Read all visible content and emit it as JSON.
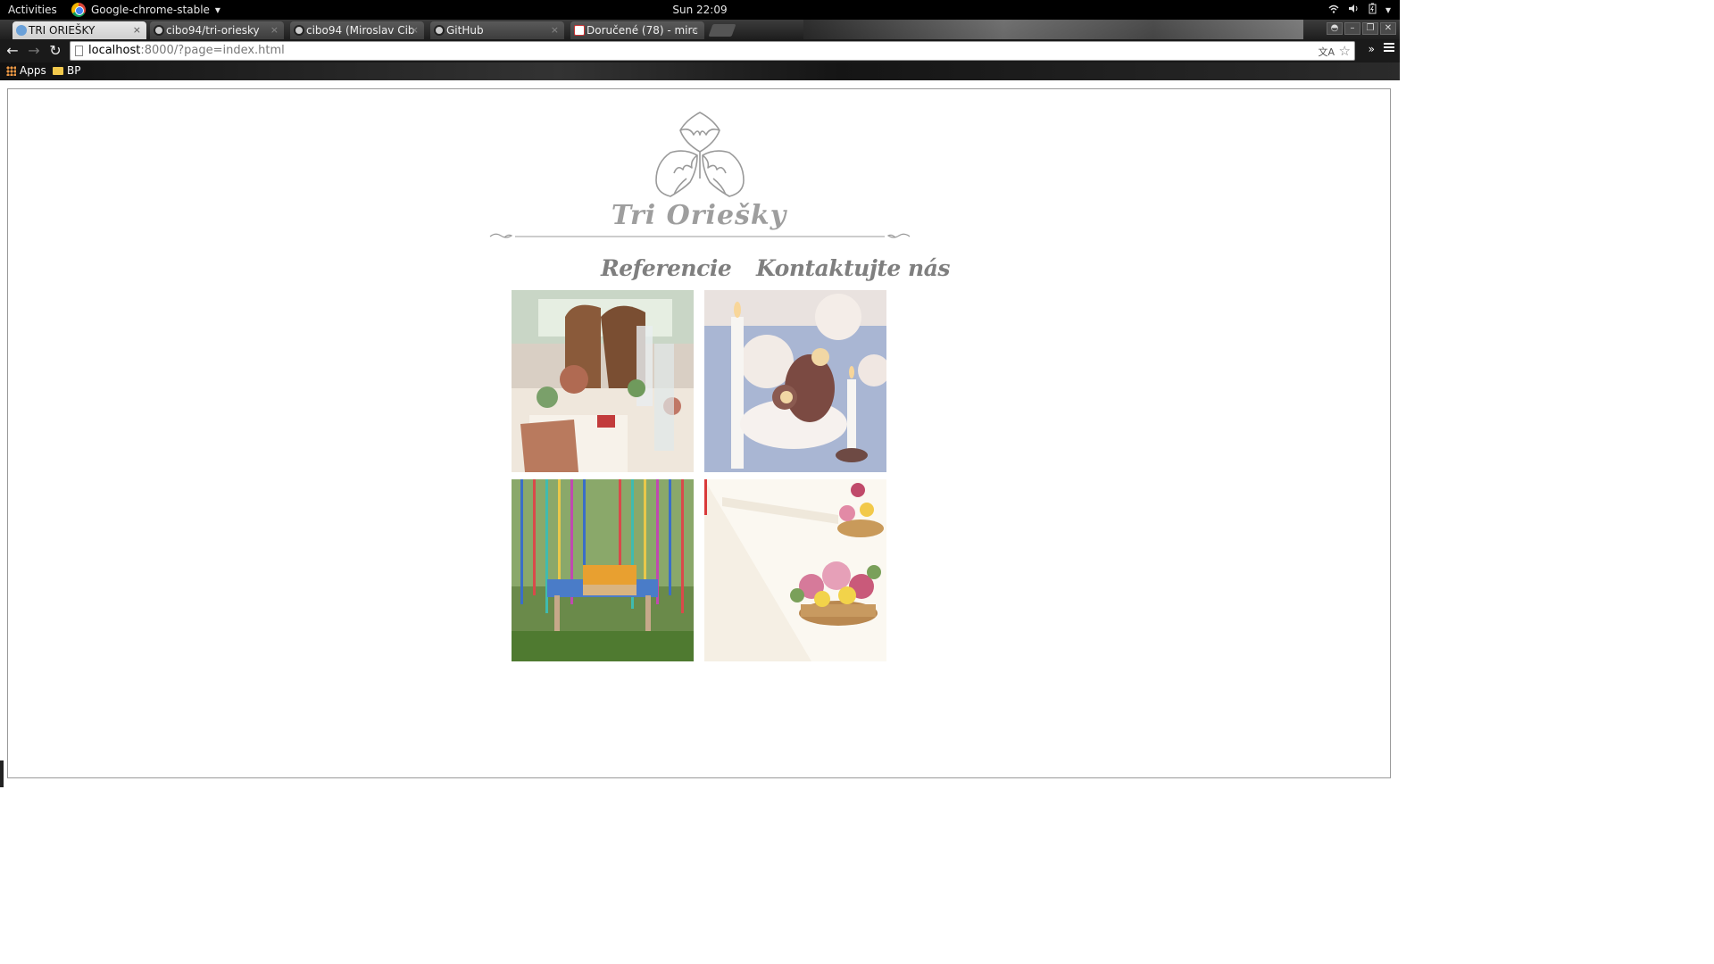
{
  "system_bar": {
    "activities": "Activities",
    "app_name": "Google-chrome-stable",
    "clock": "Sun 22:09"
  },
  "tabs": [
    {
      "title": "TRI ORIEŠKY",
      "active": true
    },
    {
      "title": "cibo94/tri-oriesky",
      "active": false
    },
    {
      "title": "cibo94 (Miroslav Cib",
      "active": false
    },
    {
      "title": "GitHub",
      "active": false
    },
    {
      "title": "Doručené (78) - mirc",
      "active": false
    }
  ],
  "address_bar": {
    "host": "localhost",
    "rest": ":8000/?page=index.html"
  },
  "bookmarks": [
    {
      "label": "Apps",
      "icon": "apps-grid-icon"
    },
    {
      "label": "BP",
      "icon": "folder-icon"
    }
  ],
  "site": {
    "title": "Tri Oriešky",
    "nav": [
      {
        "label": "Referencie"
      },
      {
        "label": "Kontaktujte nás"
      }
    ],
    "gallery": [
      {
        "subject": "table setting with copper apple and books"
      },
      {
        "subject": "candles and roses on blue table"
      },
      {
        "subject": "garden table with colorful ribbons"
      },
      {
        "subject": "flower baskets on white table"
      }
    ]
  },
  "colors": {
    "title_gray": "#9e9e9e",
    "nav_gray": "#7f7f7f",
    "logo_stroke": "#9a9a9a"
  }
}
